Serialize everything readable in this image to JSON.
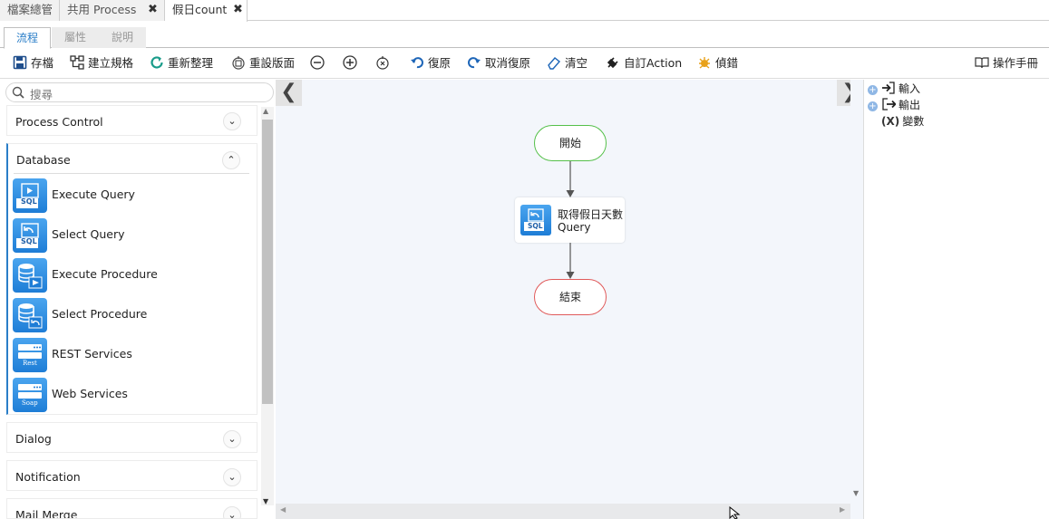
{
  "doc_tabs": [
    {
      "label": "檔案總管",
      "closable": false
    },
    {
      "label": "共用 Process",
      "closable": true
    },
    {
      "label": "假日count",
      "closable": true,
      "active": true
    }
  ],
  "close_glyph": "✖",
  "view_tabs": [
    {
      "label": "流程",
      "active": true
    },
    {
      "label": "屬性",
      "active": false
    },
    {
      "label": "說明",
      "active": false
    }
  ],
  "toolbar": {
    "save": "存檔",
    "create_spec": "建立規格",
    "refresh": "重新整理",
    "reset_layout": "重設版面",
    "undo": "復原",
    "redo": "取消復原",
    "clear": "清空",
    "custom_action": "自訂Action",
    "debug": "偵錯",
    "manual": "操作手冊"
  },
  "sidebar": {
    "search_placeholder": "搜尋",
    "sections": [
      {
        "title": "Process Control",
        "expanded": false
      },
      {
        "title": "Database",
        "expanded": true,
        "items": [
          {
            "label": "Execute Query",
            "icon": "sql-execute-icon",
            "badge": "SQL"
          },
          {
            "label": "Select Query",
            "icon": "sql-select-icon",
            "badge": "SQL"
          },
          {
            "label": "Execute Procedure",
            "icon": "db-execute-icon",
            "badge": ""
          },
          {
            "label": "Select Procedure",
            "icon": "db-select-icon",
            "badge": ""
          },
          {
            "label": "REST Services",
            "icon": "rest-icon",
            "badge": "Rest"
          },
          {
            "label": "Web Services",
            "icon": "soap-icon",
            "badge": "Soap"
          }
        ]
      },
      {
        "title": "Dialog",
        "expanded": false
      },
      {
        "title": "Notification",
        "expanded": false
      },
      {
        "title": "Mail Merge",
        "expanded": false
      }
    ]
  },
  "flow": {
    "start": "開始",
    "query_node": {
      "line1": "取得假日天數",
      "line2": "Query",
      "badge": "SQL"
    },
    "end": "結束"
  },
  "right_panel": {
    "input": "輸入",
    "output": "輸出",
    "variables_prefix": "(X)",
    "variables": "變數"
  },
  "colors": {
    "accent": "#2a7ec8",
    "start_border": "#55c04a",
    "end_border": "#e05a5a",
    "icon_blue": "#1e7dd6"
  }
}
